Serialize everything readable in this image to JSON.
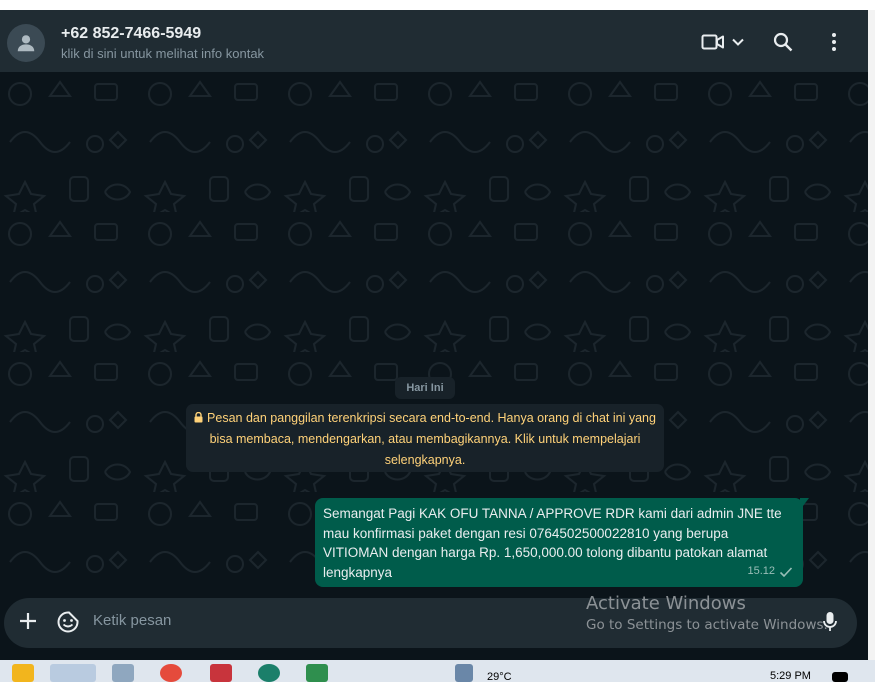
{
  "header": {
    "contact_name": "+62 852-7466-5949",
    "contact_subtitle": "klik di sini untuk melihat info kontak"
  },
  "chat": {
    "date_label": "Hari Ini",
    "encryption_notice": "Pesan dan panggilan terenkripsi secara end-to-end. Hanya orang di chat ini yang bisa membaca, mendengarkan, atau membagikannya. Klik untuk mempelajari selengkapnya.",
    "messages": [
      {
        "text": "Semangat Pagi KAK OFU TANNA / APPROVE RDR kami dari admin JNE tte mau konfirmasi paket dengan resi 0764502500022810 yang berupa VITIOMAN dengan harga Rp. 1,650,000.00 tolong dibantu patokan alamat lengkapnya",
        "time": "15.12",
        "status": "sent"
      }
    ]
  },
  "composer": {
    "placeholder": "Ketik pesan"
  },
  "watermark": {
    "title": "Activate Windows",
    "subtitle": "Go to Settings to activate Windows."
  },
  "taskbar": {
    "clock": "5:29 PM",
    "partial_text": "29°C"
  },
  "colors": {
    "header_bg": "#202c33",
    "chat_bg": "#0b141a",
    "outgoing_bubble": "#005c4b",
    "notice_text": "#ffd279"
  }
}
